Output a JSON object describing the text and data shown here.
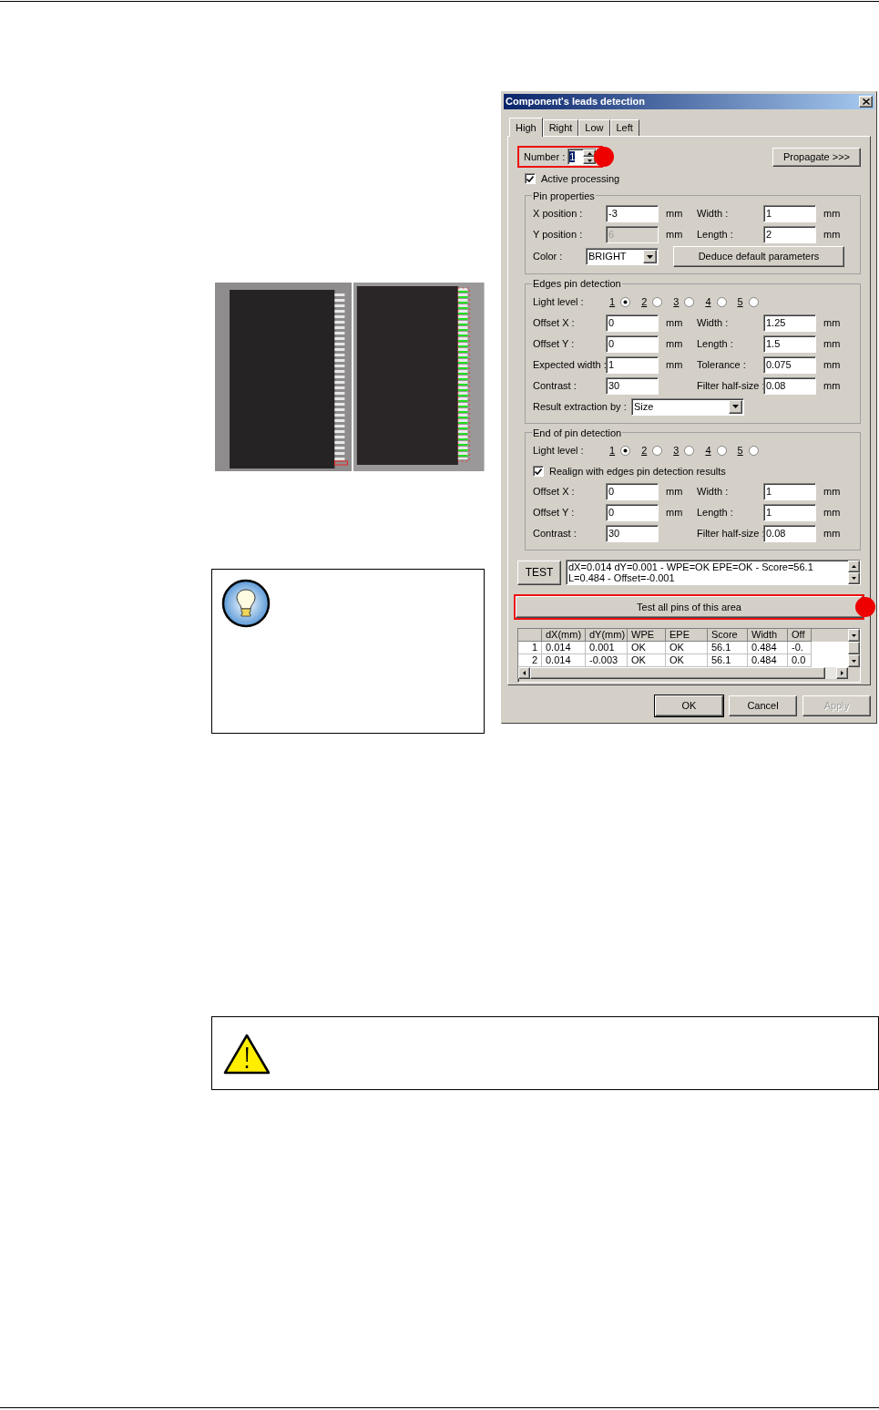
{
  "dialog": {
    "title": "Component's leads detection",
    "tabs": [
      {
        "label": "High",
        "selected": true
      },
      {
        "label": "Right",
        "selected": false
      },
      {
        "label": "Low",
        "selected": false
      },
      {
        "label": "Left",
        "selected": false
      }
    ],
    "number": {
      "label": "Number :",
      "value": "1",
      "highlighted": true
    },
    "propagate_button": "Propagate >>>",
    "active_processing": {
      "label": "Active processing",
      "checked": true
    },
    "sections": [
      {
        "title": "Pin properties",
        "rows": [
          {
            "kind": "fields",
            "fields": [
              {
                "label": "X position :",
                "value": "-3",
                "unit": "mm",
                "disabled": false
              },
              {
                "label": "Width :",
                "value": "1",
                "unit": "mm",
                "disabled": false
              }
            ]
          },
          {
            "kind": "fields",
            "fields": [
              {
                "label": "Y position :",
                "value": "6",
                "unit": "mm",
                "disabled": true
              },
              {
                "label": "Length :",
                "value": "2",
                "unit": "mm",
                "disabled": false
              }
            ]
          },
          {
            "kind": "select_button",
            "label": "Color :",
            "value": "BRIGHT",
            "button": "Deduce default parameters"
          }
        ]
      },
      {
        "title": "Edges pin detection",
        "rows": [
          {
            "kind": "radios",
            "label": "Light level :",
            "options": [
              {
                "label": "1",
                "selected": true
              },
              {
                "label": "2",
                "selected": false
              },
              {
                "label": "3",
                "selected": false
              },
              {
                "label": "4",
                "selected": false
              },
              {
                "label": "5",
                "selected": false
              }
            ]
          },
          {
            "kind": "fields",
            "fields": [
              {
                "label": "Offset X :",
                "value": "0",
                "unit": "mm",
                "disabled": false
              },
              {
                "label": "Width :",
                "value": "1.25",
                "unit": "mm",
                "disabled": false
              }
            ]
          },
          {
            "kind": "fields",
            "fields": [
              {
                "label": "Offset Y :",
                "value": "0",
                "unit": "mm",
                "disabled": false
              },
              {
                "label": "Length :",
                "value": "1.5",
                "unit": "mm",
                "disabled": false
              }
            ]
          },
          {
            "kind": "fields",
            "fields": [
              {
                "label": "Expected width :",
                "value": "1",
                "unit": "mm",
                "disabled": false
              },
              {
                "label": "Tolerance :",
                "value": "0.075",
                "unit": "mm",
                "disabled": false
              }
            ]
          },
          {
            "kind": "fields",
            "fields": [
              {
                "label": "Contrast :",
                "value": "30",
                "disabled": false
              },
              {
                "label": "Filter half-size :",
                "value": "0.08",
                "unit": "mm",
                "disabled": false
              }
            ]
          },
          {
            "kind": "select",
            "label": "Result extraction by :",
            "value": "Size"
          }
        ]
      },
      {
        "title": "End of pin detection",
        "rows": [
          {
            "kind": "radios",
            "label": "Light level :",
            "options": [
              {
                "label": "1",
                "selected": true
              },
              {
                "label": "2",
                "selected": false
              },
              {
                "label": "3",
                "selected": false
              },
              {
                "label": "4",
                "selected": false
              },
              {
                "label": "5",
                "selected": false
              }
            ]
          },
          {
            "kind": "checkbox",
            "label": "Realign with edges pin detection results",
            "checked": true
          },
          {
            "kind": "fields",
            "fields": [
              {
                "label": "Offset X :",
                "value": "0",
                "unit": "mm",
                "disabled": false
              },
              {
                "label": "Width :",
                "value": "1",
                "unit": "mm",
                "disabled": false
              }
            ]
          },
          {
            "kind": "fields",
            "fields": [
              {
                "label": "Offset Y :",
                "value": "0",
                "unit": "mm",
                "disabled": false
              },
              {
                "label": "Length :",
                "value": "1",
                "unit": "mm",
                "disabled": false
              }
            ]
          },
          {
            "kind": "fields",
            "fields": [
              {
                "label": "Contrast :",
                "value": "30",
                "disabled": false
              },
              {
                "label": "Filter half-size :",
                "value": "0.08",
                "unit": "mm",
                "disabled": false
              }
            ]
          }
        ]
      }
    ],
    "test_button": "TEST",
    "test_result": [
      "dX=0.014 dY=0.001 - WPE=OK EPE=OK - Score=56.1",
      "L=0.484 - Offset=-0.001"
    ],
    "test_all": {
      "label": "Test all pins of this area",
      "highlighted": true
    },
    "table": {
      "columns": [
        "dX(mm)",
        "dY(mm)",
        "WPE",
        "EPE",
        "Score",
        "Width",
        "Off"
      ],
      "rows": [
        {
          "index": "1",
          "cells": [
            "0.014",
            "0.001",
            "OK",
            "OK",
            "56.1",
            "0.484",
            "-0."
          ]
        },
        {
          "index": "2",
          "cells": [
            "0.014",
            "-0.003",
            "OK",
            "OK",
            "56.1",
            "0.484",
            "0.0"
          ]
        }
      ]
    },
    "buttons": [
      {
        "label": "OK",
        "disabled": false,
        "default": true
      },
      {
        "label": "Cancel",
        "disabled": false,
        "default": false
      },
      {
        "label": "Apply",
        "disabled": true,
        "default": false
      }
    ]
  }
}
